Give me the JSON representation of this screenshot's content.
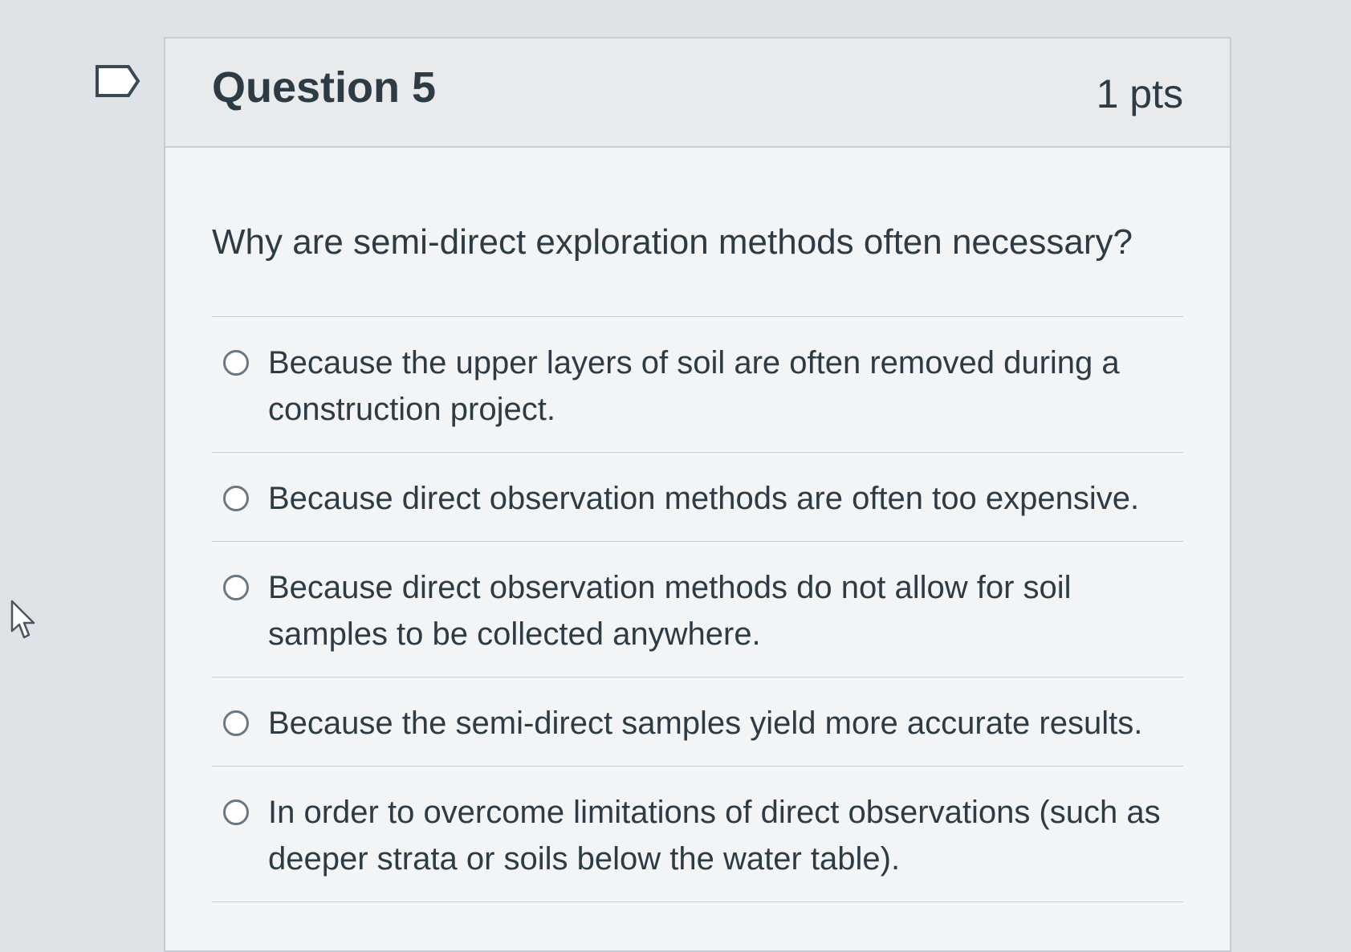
{
  "question": {
    "title": "Question 5",
    "points": "1 pts",
    "text": "Why are semi-direct exploration methods often necessary?"
  },
  "answers": [
    {
      "label": "Because the upper layers of soil are often removed during a construction project."
    },
    {
      "label": "Because direct observation methods are often too expensive."
    },
    {
      "label": "Because direct observation methods do not allow for soil samples to be collected anywhere."
    },
    {
      "label": "Because the semi-direct samples yield more accurate results."
    },
    {
      "label": "In order to overcome limitations of direct observations (such as deeper strata or soils below the water table)."
    }
  ],
  "icons": {
    "flag": "flag-question-icon",
    "cursor": "mouse-pointer-icon"
  },
  "colors": {
    "text": "#2d3b45",
    "border": "#c7cdd1",
    "header_bg": "#e8eaec"
  }
}
